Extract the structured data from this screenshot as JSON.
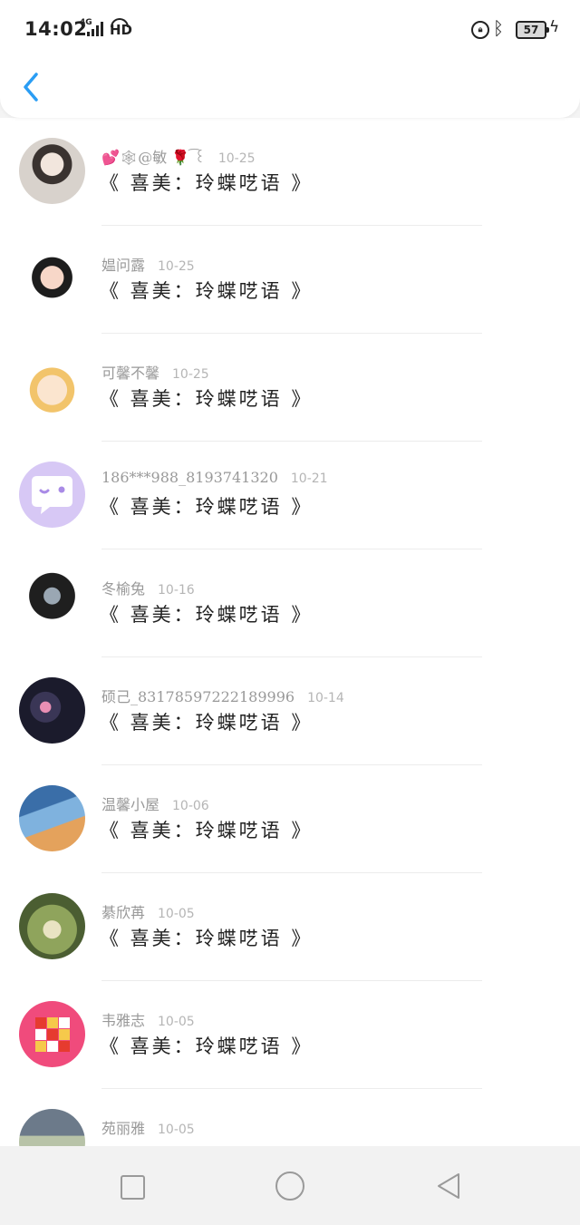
{
  "status": {
    "time": "14:02",
    "network": "4G",
    "hd": "HD",
    "battery": "57"
  },
  "items": [
    {
      "name": "💕🕸@敏 🌹 ͡꒰",
      "date": "10-25",
      "title": "《 喜美：玲蝶呓语 》",
      "avatar": {
        "type": "girl-photo",
        "colors": [
          "#d8d2cc",
          "#3a3330",
          "#f2e6dd"
        ]
      }
    },
    {
      "name": "媪问露",
      "date": "10-25",
      "title": "《 喜美：玲蝶呓语 》",
      "avatar": {
        "type": "cartoon-girl",
        "colors": [
          "#ffffff",
          "#1d1d1d",
          "#f7d7c8"
        ]
      }
    },
    {
      "name": "可馨不馨",
      "date": "10-25",
      "title": "《 喜美：玲蝶呓语 》",
      "avatar": {
        "type": "cartoon-sheep",
        "colors": [
          "#ffffff",
          "#f2c46b",
          "#fbe5cf"
        ]
      }
    },
    {
      "name": "186***988_8193741320",
      "date": "10-21",
      "title": "《 喜美：玲蝶呓语 》",
      "avatar": {
        "type": "chat-default",
        "colors": [
          "#d7c8f5",
          "#ffffff",
          "#a98be6"
        ]
      }
    },
    {
      "name": "冬榆兔",
      "date": "10-16",
      "title": "《 喜美：玲蝶呓语 》",
      "avatar": {
        "type": "cartoon-hat-girl",
        "colors": [
          "#ffffff",
          "#1f1f1f",
          "#9aa7b3"
        ]
      }
    },
    {
      "name": "硕己_83178597222189996",
      "date": "10-14",
      "title": "《 喜美：玲蝶呓语 》",
      "avatar": {
        "type": "night-text",
        "colors": [
          "#1b1b2c",
          "#e98fb4",
          "#3a3656"
        ]
      }
    },
    {
      "name": "温馨小屋",
      "date": "10-06",
      "title": "《 喜美：玲蝶呓语 》",
      "avatar": {
        "type": "window-scene",
        "colors": [
          "#3a6ea8",
          "#e4a25c",
          "#7fb2de"
        ]
      }
    },
    {
      "name": "綦欣苒",
      "date": "10-05",
      "title": "《 喜美：玲蝶呓语 》",
      "avatar": {
        "type": "outdoor-photo",
        "colors": [
          "#8fa45c",
          "#e9e3c2",
          "#4b5e32"
        ]
      }
    },
    {
      "name": "韦雅志",
      "date": "10-05",
      "title": "《 喜美：玲蝶呓语 》",
      "avatar": {
        "type": "rubik-cube",
        "colors": [
          "#f04b7c",
          "#f6c94b",
          "#e63b2f"
        ]
      }
    },
    {
      "name": "苑丽雅",
      "date": "10-05",
      "title": "",
      "avatar": {
        "type": "photo",
        "colors": [
          "#b8c3a8",
          "#6c7a8a",
          "#e2d6c2"
        ]
      }
    }
  ]
}
